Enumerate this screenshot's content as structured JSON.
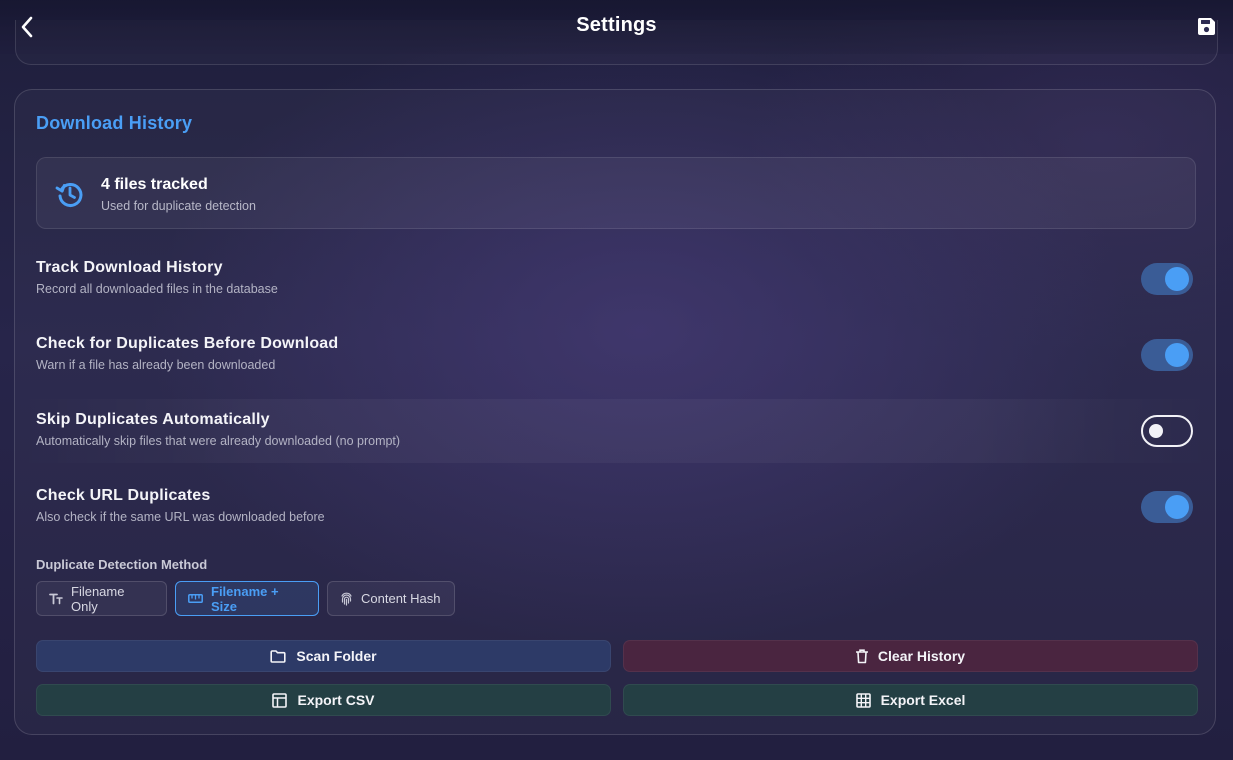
{
  "header": {
    "title": "Settings",
    "back_icon": "chevron-left-icon",
    "save_icon": "floppy-disk-icon"
  },
  "download_history": {
    "section_title": "Download History",
    "stats": {
      "icon": "history-icon",
      "count_text": "4 files tracked",
      "subtitle": "Used for duplicate detection"
    },
    "settings": [
      {
        "title": "Track Download History",
        "description": "Record all downloaded files in the database",
        "enabled": true
      },
      {
        "title": "Check for Duplicates Before Download",
        "description": "Warn if a file has already been downloaded",
        "enabled": true
      },
      {
        "title": "Skip Duplicates Automatically",
        "description": "Automatically skip files that were already downloaded (no prompt)",
        "enabled": false
      },
      {
        "title": "Check URL Duplicates",
        "description": "Also check if the same URL was downloaded before",
        "enabled": true
      }
    ],
    "detection_method": {
      "label": "Duplicate Detection Method",
      "options": [
        {
          "label": "Filename Only",
          "icon": "text-size-icon",
          "selected": false
        },
        {
          "label": "Filename + Size",
          "icon": "ruler-icon",
          "selected": true
        },
        {
          "label": "Content Hash",
          "icon": "fingerprint-icon",
          "selected": false
        }
      ]
    },
    "actions": {
      "scan_folder": "Scan Folder",
      "clear_history": "Clear History",
      "export_csv": "Export CSV",
      "export_excel": "Export Excel"
    }
  },
  "colors": {
    "accent": "#4a9ef5",
    "toggle_track_on": "#3a5c96",
    "scan_button": "#2d3a67",
    "clear_button": "#4a2540",
    "export_button": "#243f44"
  }
}
